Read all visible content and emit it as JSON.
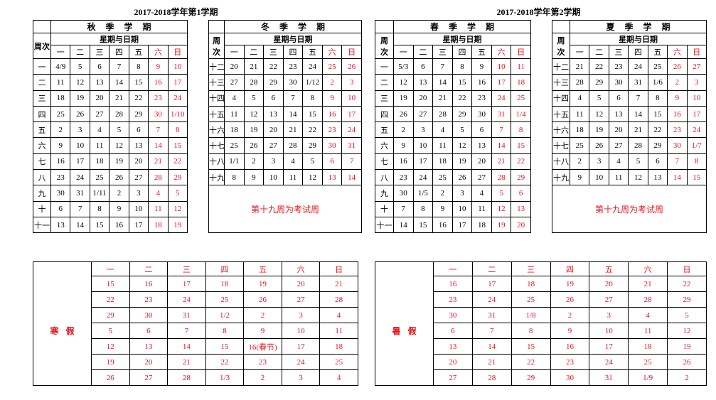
{
  "titles": [
    "2017-2018学年第1学期",
    "2017-2018学年第2学期"
  ],
  "days": [
    "一",
    "二",
    "三",
    "四",
    "五",
    "六",
    "日"
  ],
  "subheader": "星期与日期",
  "week_col_header": "周次",
  "week_col_header_split": [
    "周",
    "次"
  ],
  "terms": [
    {
      "season": "秋季学期",
      "rows": [
        {
          "week": "一",
          "d": [
            "4/9",
            "5",
            "6",
            "7",
            "8",
            "9",
            "10"
          ]
        },
        {
          "week": "二",
          "d": [
            "11",
            "12",
            "13",
            "14",
            "15",
            "16",
            "17"
          ]
        },
        {
          "week": "三",
          "d": [
            "18",
            "19",
            "20",
            "21",
            "22",
            "23",
            "24"
          ]
        },
        {
          "week": "四",
          "d": [
            "25",
            "26",
            "27",
            "28",
            "29",
            "30",
            "1/10"
          ]
        },
        {
          "week": "五",
          "d": [
            "2",
            "3",
            "4",
            "5",
            "6",
            "7",
            "8"
          ]
        },
        {
          "week": "六",
          "d": [
            "9",
            "10",
            "11",
            "12",
            "13",
            "14",
            "15"
          ]
        },
        {
          "week": "七",
          "d": [
            "16",
            "17",
            "18",
            "19",
            "20",
            "21",
            "22"
          ]
        },
        {
          "week": "八",
          "d": [
            "23",
            "24",
            "25",
            "26",
            "27",
            "28",
            "29"
          ]
        },
        {
          "week": "九",
          "d": [
            "30",
            "31",
            "1/11",
            "2",
            "3",
            "4",
            "5"
          ]
        },
        {
          "week": "十",
          "d": [
            "6",
            "7",
            "8",
            "9",
            "10",
            "11",
            "12"
          ]
        },
        {
          "week": "十一",
          "d": [
            "13",
            "14",
            "15",
            "16",
            "17",
            "18",
            "19"
          ]
        }
      ]
    },
    {
      "season": "冬季学期",
      "rows": [
        {
          "week": "十二",
          "d": [
            "20",
            "21",
            "22",
            "23",
            "24",
            "25",
            "26"
          ]
        },
        {
          "week": "十三",
          "d": [
            "27",
            "28",
            "29",
            "30",
            "1/12",
            "2",
            "3"
          ]
        },
        {
          "week": "十四",
          "d": [
            "4",
            "5",
            "6",
            "7",
            "8",
            "9",
            "10"
          ]
        },
        {
          "week": "十五",
          "d": [
            "11",
            "12",
            "13",
            "14",
            "15",
            "16",
            "17"
          ]
        },
        {
          "week": "十六",
          "d": [
            "18",
            "19",
            "20",
            "21",
            "22",
            "23",
            "24"
          ]
        },
        {
          "week": "十七",
          "d": [
            "25",
            "26",
            "27",
            "28",
            "29",
            "30",
            "31"
          ]
        },
        {
          "week": "十八",
          "d": [
            "1/1",
            "2",
            "3",
            "4",
            "5",
            "6",
            "7"
          ]
        },
        {
          "week": "十九",
          "d": [
            "8",
            "9",
            "10",
            "11",
            "12",
            "13",
            "14"
          ]
        }
      ],
      "note": "第十九周为考试周"
    },
    {
      "season": "春季学期",
      "rows": [
        {
          "week": "一",
          "d": [
            "5/3",
            "6",
            "7",
            "8",
            "9",
            "10",
            "11"
          ]
        },
        {
          "week": "二",
          "d": [
            "12",
            "13",
            "14",
            "15",
            "16",
            "17",
            "18"
          ]
        },
        {
          "week": "三",
          "d": [
            "19",
            "20",
            "21",
            "22",
            "23",
            "24",
            "25"
          ]
        },
        {
          "week": "四",
          "d": [
            "26",
            "27",
            "28",
            "29",
            "30",
            "31",
            "1/4"
          ]
        },
        {
          "week": "五",
          "d": [
            "2",
            "3",
            "4",
            "5",
            "6",
            "7",
            "8"
          ]
        },
        {
          "week": "六",
          "d": [
            "9",
            "10",
            "11",
            "12",
            "13",
            "14",
            "15"
          ]
        },
        {
          "week": "七",
          "d": [
            "16",
            "17",
            "18",
            "19",
            "20",
            "21",
            "22"
          ]
        },
        {
          "week": "八",
          "d": [
            "23",
            "24",
            "25",
            "26",
            "27",
            "28",
            "29"
          ]
        },
        {
          "week": "九",
          "d": [
            "30",
            "1/5",
            "2",
            "3",
            "4",
            "5",
            "6"
          ]
        },
        {
          "week": "十",
          "d": [
            "7",
            "8",
            "9",
            "10",
            "11",
            "12",
            "13"
          ]
        },
        {
          "week": "十一",
          "d": [
            "14",
            "15",
            "16",
            "17",
            "18",
            "19",
            "20"
          ]
        }
      ]
    },
    {
      "season": "夏季学期",
      "rows": [
        {
          "week": "十二",
          "d": [
            "21",
            "22",
            "23",
            "24",
            "25",
            "26",
            "27"
          ]
        },
        {
          "week": "十三",
          "d": [
            "28",
            "29",
            "30",
            "31",
            "1/6",
            "2",
            "3"
          ]
        },
        {
          "week": "十四",
          "d": [
            "4",
            "5",
            "6",
            "7",
            "8",
            "9",
            "10"
          ]
        },
        {
          "week": "十五",
          "d": [
            "11",
            "12",
            "13",
            "14",
            "15",
            "16",
            "17"
          ]
        },
        {
          "week": "十六",
          "d": [
            "18",
            "19",
            "20",
            "21",
            "22",
            "23",
            "24"
          ]
        },
        {
          "week": "十七",
          "d": [
            "25",
            "26",
            "27",
            "28",
            "29",
            "30",
            "1/7"
          ]
        },
        {
          "week": "十八",
          "d": [
            "2",
            "3",
            "4",
            "5",
            "6",
            "7",
            "8"
          ]
        },
        {
          "week": "十九",
          "d": [
            "9",
            "10",
            "11",
            "12",
            "13",
            "14",
            "15"
          ]
        }
      ],
      "note": "第十九周为考试周"
    }
  ],
  "vacations": [
    {
      "label": "寒假",
      "rows": [
        [
          "15",
          "16",
          "17",
          "18",
          "19",
          "20",
          "21"
        ],
        [
          "22",
          "23",
          "24",
          "25",
          "26",
          "27",
          "28"
        ],
        [
          "29",
          "30",
          "31",
          "1/2",
          "2",
          "3",
          "4"
        ],
        [
          "5",
          "6",
          "7",
          "8",
          "9",
          "10",
          "11"
        ],
        [
          "12",
          "13",
          "14",
          "15",
          "16(春节)",
          "17",
          "18"
        ],
        [
          "19",
          "20",
          "21",
          "22",
          "23",
          "24",
          "25"
        ],
        [
          "26",
          "27",
          "28",
          "1/3",
          "2",
          "3",
          "4"
        ]
      ]
    },
    {
      "label": "暑假",
      "rows": [
        [
          "16",
          "17",
          "18",
          "19",
          "20",
          "21",
          "22"
        ],
        [
          "23",
          "24",
          "25",
          "26",
          "27",
          "28",
          "29"
        ],
        [
          "30",
          "31",
          "1/8",
          "2",
          "3",
          "4",
          "5"
        ],
        [
          "6",
          "7",
          "8",
          "9",
          "10",
          "11",
          "12"
        ],
        [
          "13",
          "14",
          "15",
          "16",
          "17",
          "18",
          "19"
        ],
        [
          "20",
          "21",
          "22",
          "23",
          "24",
          "25",
          "26"
        ],
        [
          "27",
          "28",
          "29",
          "30",
          "31",
          "1/9",
          "2"
        ]
      ]
    }
  ],
  "colors": {
    "weekend": "#e8141b",
    "text": "#000000"
  }
}
